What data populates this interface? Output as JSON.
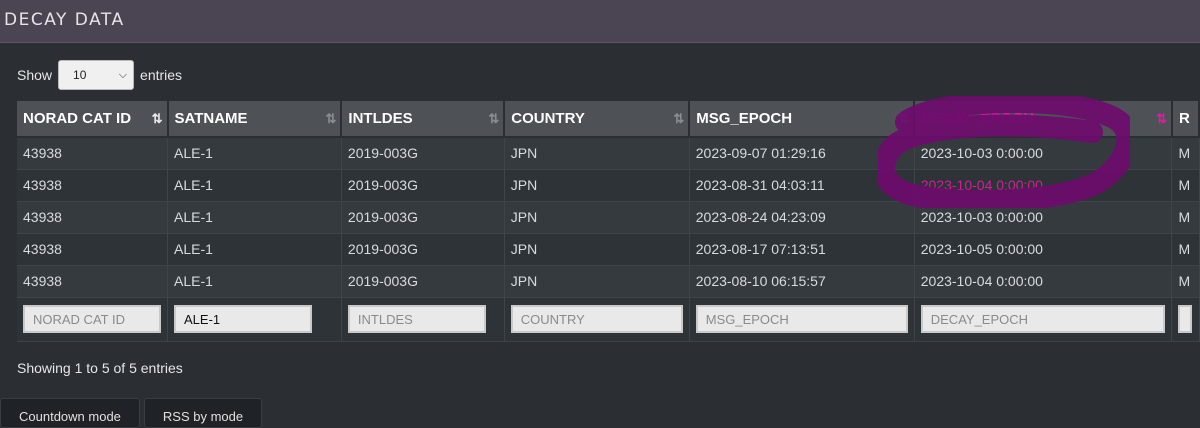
{
  "app": {
    "title": "DECAY DATA"
  },
  "length": {
    "show_label": "Show",
    "value": "10",
    "entries_label": "entries"
  },
  "columns": [
    {
      "key": "norad",
      "label": "NORAD CAT ID"
    },
    {
      "key": "satname",
      "label": "SATNAME"
    },
    {
      "key": "intldes",
      "label": "INTLDES"
    },
    {
      "key": "country",
      "label": "COUNTRY"
    },
    {
      "key": "msg_epoch",
      "label": "MSG_EPOCH"
    },
    {
      "key": "decay_epoch",
      "label": "DECAY_EPOCH"
    },
    {
      "key": "rcs",
      "label": "R"
    }
  ],
  "rows": [
    {
      "norad": "43938",
      "satname": "ALE-1",
      "intldes": "2019-003G",
      "country": "JPN",
      "msg_epoch": "2023-09-07 01:29:16",
      "decay_epoch": "2023-10-03 0:00:00",
      "rcs": "M"
    },
    {
      "norad": "43938",
      "satname": "ALE-1",
      "intldes": "2019-003G",
      "country": "JPN",
      "msg_epoch": "2023-08-31 04:03:11",
      "decay_epoch": "2023-10-04 0:00:00",
      "rcs": "M"
    },
    {
      "norad": "43938",
      "satname": "ALE-1",
      "intldes": "2019-003G",
      "country": "JPN",
      "msg_epoch": "2023-08-24 04:23:09",
      "decay_epoch": "2023-10-03 0:00:00",
      "rcs": "M"
    },
    {
      "norad": "43938",
      "satname": "ALE-1",
      "intldes": "2019-003G",
      "country": "JPN",
      "msg_epoch": "2023-08-17 07:13:51",
      "decay_epoch": "2023-10-05 0:00:00",
      "rcs": "M"
    },
    {
      "norad": "43938",
      "satname": "ALE-1",
      "intldes": "2019-003G",
      "country": "JPN",
      "msg_epoch": "2023-08-10 06:15:57",
      "decay_epoch": "2023-10-04 0:00:00",
      "rcs": "M"
    }
  ],
  "filters": {
    "norad": {
      "placeholder": "NORAD CAT ID",
      "value": ""
    },
    "satname": {
      "placeholder": "SATNAME",
      "value": "ALE-1"
    },
    "intldes": {
      "placeholder": "INTLDES",
      "value": ""
    },
    "country": {
      "placeholder": "COUNTRY",
      "value": ""
    },
    "msg_epoch": {
      "placeholder": "MSG_EPOCH",
      "value": ""
    },
    "decay_epoch": {
      "placeholder": "DECAY_EPOCH",
      "value": ""
    }
  },
  "info": "Showing 1 to 5 of 5 entries",
  "buttons": [
    "Countdown mode",
    "RSS by mode"
  ],
  "colors": {
    "accent": "#e21aa6",
    "annotation": "#7a0f78"
  },
  "sort": {
    "column": "decay_epoch",
    "direction": "desc"
  }
}
